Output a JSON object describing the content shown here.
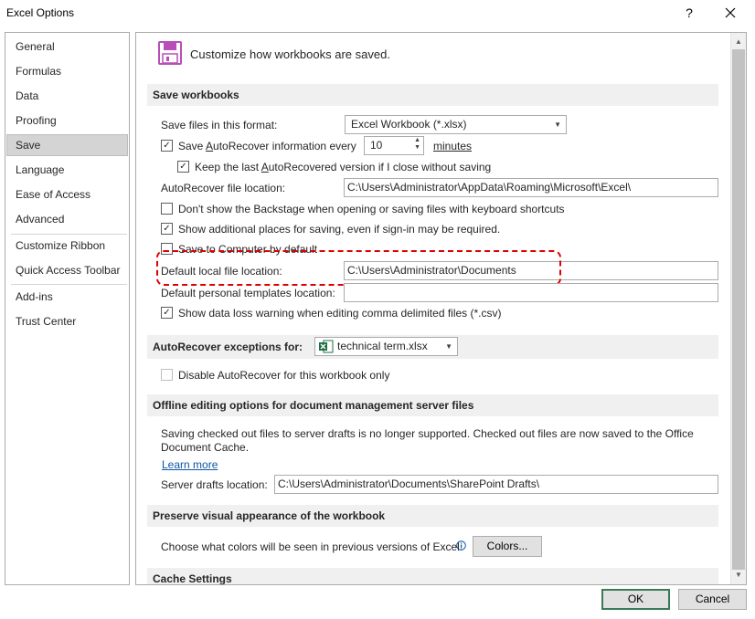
{
  "window": {
    "title": "Excel Options",
    "help_label": "?",
    "close_label": "✕"
  },
  "sidebar": {
    "items": [
      {
        "label": "General"
      },
      {
        "label": "Formulas"
      },
      {
        "label": "Data"
      },
      {
        "label": "Proofing"
      },
      {
        "label": "Save",
        "selected": true
      },
      {
        "label": "Language"
      },
      {
        "label": "Ease of Access"
      },
      {
        "label": "Advanced"
      },
      {
        "label": "Customize Ribbon"
      },
      {
        "label": "Quick Access Toolbar"
      },
      {
        "label": "Add-ins"
      },
      {
        "label": "Trust Center"
      }
    ]
  },
  "header": {
    "title": "Customize how workbooks are saved."
  },
  "save_workbooks": {
    "section_title": "Save workbooks",
    "format_label": "Save files in this format:",
    "format_value": "Excel Workbook (*.xlsx)",
    "autorecover_label_pre": "Save ",
    "autorecover_label_u": "A",
    "autorecover_label_post": "utoRecover information every",
    "autorecover_checked": true,
    "autorecover_minutes": "10",
    "minutes_label": "minutes",
    "keep_last_label_pre": "Keep the last ",
    "keep_last_label_u": "A",
    "keep_last_label_post": "utoRecovered version if I close without saving",
    "keep_last_checked": true,
    "autorecover_location_label": "AutoRecover file location:",
    "autorecover_location_value": "C:\\Users\\Administrator\\AppData\\Roaming\\Microsoft\\Excel\\",
    "backstage_label": "Don't show the Backstage when opening or saving files with keyboard shortcuts",
    "backstage_checked": false,
    "additional_places_label": "Show additional places for saving, even if sign-in may be required.",
    "additional_places_checked": true,
    "save_to_computer_label": "Save to Computer by default",
    "save_to_computer_checked": false,
    "default_local_label": "Default local file location:",
    "default_local_value": "C:\\Users\\Administrator\\Documents",
    "templates_label": "Default personal templates location:",
    "templates_value": "",
    "data_loss_label": "Show data loss warning when editing comma delimited files (*.csv)",
    "data_loss_checked": true
  },
  "autorecover_exceptions": {
    "section_title": "AutoRecover exceptions for:",
    "workbook_value": "technical term.xlsx",
    "disable_label": "Disable AutoRecover for this workbook only",
    "disable_checked": false
  },
  "offline": {
    "section_title": "Offline editing options for document management server files",
    "description_line1": "Saving checked out files to server drafts is no longer supported. Checked out files are now saved to the Office",
    "description_line2": "Document Cache.",
    "learn_more": "Learn more",
    "drafts_label": "Server drafts location:",
    "drafts_value": "C:\\Users\\Administrator\\Documents\\SharePoint Drafts\\"
  },
  "preserve": {
    "section_title": "Preserve visual appearance of the workbook",
    "colors_label": "Choose what colors will be seen in previous versions of Excel:",
    "colors_button": "Colors..."
  },
  "cache": {
    "section_title": "Cache Settings"
  },
  "footer": {
    "ok_label": "OK",
    "cancel_label": "Cancel"
  },
  "colors": {
    "highlight_border": "#e00000",
    "ok_border": "#3a7a55",
    "link": "#0b57a5",
    "save_icon": "#b84fb8",
    "excel_icon": "#1d6f42"
  }
}
